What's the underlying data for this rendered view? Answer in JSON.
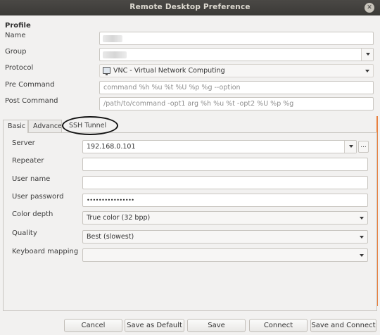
{
  "window": {
    "title": "Remote Desktop Preference",
    "close_glyph": "✕"
  },
  "profile": {
    "heading": "Profile",
    "name_label": "Name",
    "group_label": "Group",
    "protocol_label": "Protocol",
    "protocol_value": "VNC - Virtual Network Computing",
    "protocol_icon": "monitor-icon",
    "pre_command_label": "Pre Command",
    "pre_command_placeholder": "command %h %u %t %U %p %g --option",
    "post_command_label": "Post Command",
    "post_command_placeholder": "/path/to/command -opt1 arg %h %u %t -opt2 %U %p %g"
  },
  "tabs": [
    {
      "label": "Basic",
      "active": true
    },
    {
      "label": "Advance",
      "active": false
    },
    {
      "label": "SSH Tunnel",
      "active": false,
      "highlighted": true
    }
  ],
  "basic": {
    "server_label": "Server",
    "server_value": "192.168.0.101",
    "server_more": "...",
    "repeater_label": "Repeater",
    "repeater_value": "",
    "username_label": "User name",
    "username_value": "",
    "password_label": "User password",
    "password_value": "••••••••••••••••",
    "color_depth_label": "Color depth",
    "color_depth_value": "True color (32 bpp)",
    "quality_label": "Quality",
    "quality_value": "Best (slowest)",
    "keyboard_label": "Keyboard mapping",
    "keyboard_value": ""
  },
  "buttons": {
    "cancel": "Cancel",
    "save_default": "Save as Default",
    "save": "Save",
    "connect": "Connect",
    "save_connect": "Save and Connect"
  },
  "colors": {
    "titlebar": "#3b3a37",
    "accent": "#e9803f",
    "window_bg": "#f2f1f0"
  }
}
